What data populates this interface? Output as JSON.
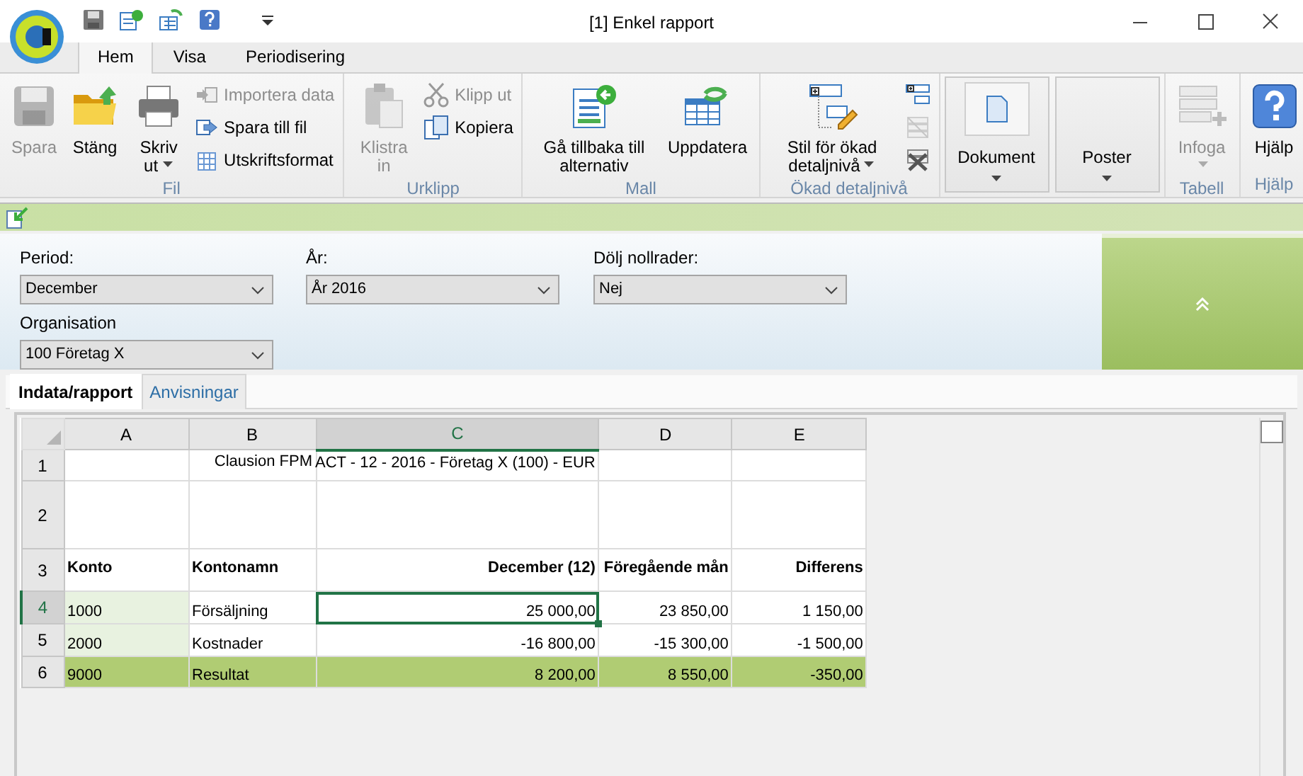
{
  "window": {
    "title": "[1] Enkel rapport"
  },
  "ribbon": {
    "tabs": [
      {
        "label": "Hem",
        "selected": true
      },
      {
        "label": "Visa",
        "selected": false
      },
      {
        "label": "Periodisering",
        "selected": false
      }
    ],
    "groups": [
      {
        "label": "Fil",
        "items": [
          {
            "kind": "large",
            "label": "Spara",
            "disabled": true,
            "dropdown": false
          },
          {
            "kind": "large",
            "label": "Stäng",
            "disabled": false,
            "dropdown": false
          },
          {
            "kind": "large",
            "label": "Skriv ut",
            "disabled": false,
            "dropdown": true
          },
          {
            "kind": "small",
            "label": "Importera data",
            "disabled": true
          },
          {
            "kind": "small",
            "label": "Spara till fil",
            "disabled": false
          },
          {
            "kind": "small",
            "label": "Utskriftsformat",
            "disabled": false
          }
        ]
      },
      {
        "label": "Urklipp",
        "items": [
          {
            "kind": "large",
            "label": "Klistra in",
            "disabled": true,
            "dropdown": false
          },
          {
            "kind": "small",
            "label": "Klipp ut",
            "disabled": true
          },
          {
            "kind": "small",
            "label": "Kopiera",
            "disabled": false
          }
        ]
      },
      {
        "label": "Mall",
        "items": [
          {
            "kind": "large",
            "label": "Gå tillbaka till alternativ",
            "disabled": false,
            "dropdown": false
          },
          {
            "kind": "large",
            "label": "Uppdatera",
            "disabled": false,
            "dropdown": false
          }
        ]
      },
      {
        "label": "Ökad detaljnivå",
        "items": [
          {
            "kind": "large",
            "label": "Stil för ökad detaljnivå",
            "disabled": false,
            "dropdown": true
          },
          {
            "kind": "icon",
            "disabled": false
          },
          {
            "kind": "icon",
            "disabled": true
          },
          {
            "kind": "icon",
            "disabled": false
          }
        ]
      },
      {
        "items": [
          {
            "kind": "panel",
            "label": "Dokument",
            "disabled": false,
            "dropdown": true
          },
          {
            "kind": "panel",
            "label": "Poster",
            "disabled": false,
            "dropdown": true
          }
        ]
      },
      {
        "label": "Tabell",
        "items": [
          {
            "kind": "large",
            "label": "Infoga",
            "disabled": true,
            "dropdown": true
          }
        ]
      },
      {
        "label": "Hjälp",
        "items": [
          {
            "kind": "large",
            "label": "Hjälp",
            "disabled": false,
            "dropdown": false
          }
        ]
      }
    ]
  },
  "filters": [
    {
      "label": "Period:",
      "value": "December"
    },
    {
      "label": "År:",
      "value": "År 2016"
    },
    {
      "label": "Dölj nollrader:",
      "value": "Nej"
    },
    {
      "label": "Organisation",
      "value": "100 Företag X"
    }
  ],
  "doc_tabs": [
    {
      "label": "Indata/rapport",
      "selected": true
    },
    {
      "label": "Anvisningar",
      "selected": false
    }
  ],
  "sheet": {
    "columns": [
      {
        "label": "A",
        "selected": false
      },
      {
        "label": "B",
        "selected": false
      },
      {
        "label": "C",
        "selected": true
      },
      {
        "label": "D",
        "selected": false
      },
      {
        "label": "E",
        "selected": false
      }
    ],
    "rows": [
      {
        "number": "1",
        "kind": "title",
        "selected": false,
        "cells": [
          "",
          "Clausion FPM",
          "ACT - 12 - 2016 - Företag X (100) - EUR",
          "",
          ""
        ]
      },
      {
        "number": "2",
        "kind": "blank",
        "selected": false,
        "cells": [
          "",
          "",
          "",
          "",
          ""
        ]
      },
      {
        "number": "3",
        "kind": "header",
        "selected": false,
        "cells": [
          "Konto",
          "Kontonamn",
          "December  (12)",
          "Föregående mån",
          "Differens"
        ]
      },
      {
        "number": "4",
        "kind": "data",
        "selected": true,
        "cells": [
          "1000",
          "Försäljning",
          "25 000,00",
          "23 850,00",
          "1 150,00"
        ]
      },
      {
        "number": "5",
        "kind": "data",
        "selected": false,
        "cells": [
          "2000",
          "Kostnader",
          "-16 800,00",
          "-15 300,00",
          "-1 500,00"
        ]
      },
      {
        "number": "6",
        "kind": "total",
        "selected": false,
        "cells": [
          "9000",
          "Resultat",
          "8 200,00",
          "8 550,00",
          "-350,00"
        ]
      }
    ]
  }
}
